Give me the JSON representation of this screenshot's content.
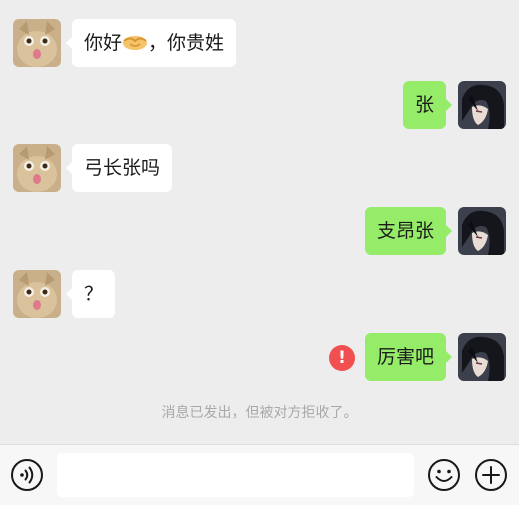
{
  "messages": [
    {
      "side": "left",
      "before_emoji": "你好",
      "emoji": "handshake-emoji",
      "text": "，你贵姓"
    },
    {
      "side": "right",
      "text": "张"
    },
    {
      "side": "left",
      "text": "弓长张吗"
    },
    {
      "side": "right",
      "text": "支昂张"
    },
    {
      "side": "left",
      "text": "？"
    },
    {
      "side": "right",
      "text": "厉害吧",
      "status": "failed"
    }
  ],
  "failed_icon": "!",
  "system_notice": "消息已发出，但被对方拒收了。",
  "input": {
    "value": "",
    "placeholder": ""
  },
  "icons": {
    "voice": "voice-icon",
    "emoji": "emoji-face-icon",
    "more": "plus-icon",
    "failed": "error-exclamation-icon"
  },
  "colors": {
    "background": "#ededed",
    "sent_bubble": "#95ec69",
    "received_bubble": "#ffffff",
    "error": "#f25050",
    "system_text": "#a9a9a9"
  }
}
